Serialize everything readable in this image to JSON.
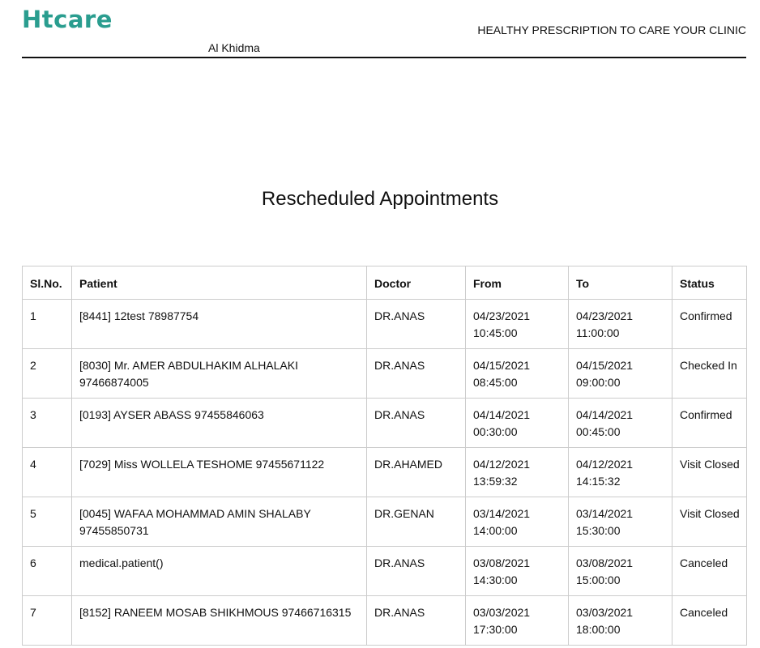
{
  "header": {
    "logo_text": "Htcare",
    "tagline": "HEALTHY PRESCRIPTION TO CARE YOUR CLINIC",
    "clinic_name": "Al Khidma"
  },
  "report": {
    "title": "Rescheduled Appointments"
  },
  "table": {
    "columns": [
      "Sl.No.",
      "Patient",
      "Doctor",
      "From",
      "To",
      "Status"
    ],
    "rows": [
      {
        "sl": "1",
        "patient": "[8441] 12test 78987754",
        "doctor": "DR.ANAS",
        "from_date": "04/23/2021",
        "from_time": "10:45:00",
        "to_date": "04/23/2021",
        "to_time": "11:00:00",
        "status": "Confirmed"
      },
      {
        "sl": "2",
        "patient": "[8030] Mr. AMER ABDULHAKIM ALHALAKI 97466874005",
        "doctor": "DR.ANAS",
        "from_date": "04/15/2021",
        "from_time": "08:45:00",
        "to_date": "04/15/2021",
        "to_time": "09:00:00",
        "status": "Checked In"
      },
      {
        "sl": "3",
        "patient": "[0193] AYSER ABASS 97455846063",
        "doctor": "DR.ANAS",
        "from_date": "04/14/2021",
        "from_time": "00:30:00",
        "to_date": "04/14/2021",
        "to_time": "00:45:00",
        "status": "Confirmed"
      },
      {
        "sl": "4",
        "patient": "[7029] Miss WOLLELA TESHOME 97455671122",
        "doctor": "DR.AHAMED",
        "from_date": "04/12/2021",
        "from_time": "13:59:32",
        "to_date": "04/12/2021",
        "to_time": "14:15:32",
        "status": "Visit Closed"
      },
      {
        "sl": "5",
        "patient": "[0045] WAFAA MOHAMMAD AMIN SHALABY 97455850731",
        "doctor": "DR.GENAN",
        "from_date": "03/14/2021",
        "from_time": "14:00:00",
        "to_date": "03/14/2021",
        "to_time": "15:30:00",
        "status": "Visit Closed"
      },
      {
        "sl": "6",
        "patient": "medical.patient()",
        "doctor": "DR.ANAS",
        "from_date": "03/08/2021",
        "from_time": "14:30:00",
        "to_date": "03/08/2021",
        "to_time": "15:00:00",
        "status": "Canceled"
      },
      {
        "sl": "7",
        "patient": "[8152] RANEEM MOSAB SHIKHMOUS 97466716315",
        "doctor": "DR.ANAS",
        "from_date": "03/03/2021",
        "from_time": "17:30:00",
        "to_date": "03/03/2021",
        "to_time": "18:00:00",
        "status": "Canceled"
      }
    ]
  }
}
